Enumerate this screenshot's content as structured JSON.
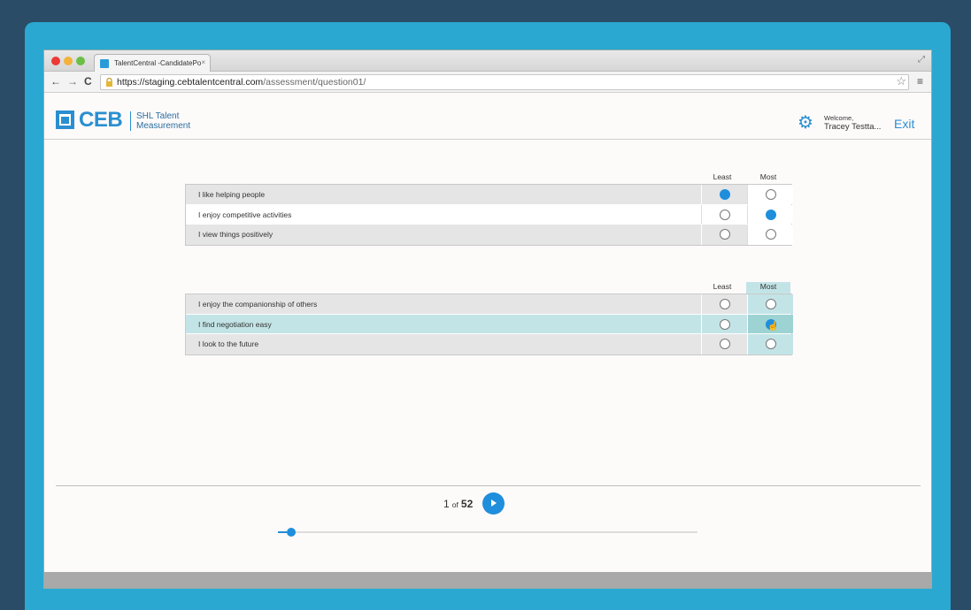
{
  "browser": {
    "tab_title": "TalentCentral -CandidatePo",
    "tab_close": "×",
    "url_host": "https://staging.cebtalentcentral.com",
    "url_path": "/assessment/question01/",
    "resize_glyph": "⤢",
    "star_glyph": "☆",
    "menu_glyph": "≡",
    "back_glyph": "←",
    "forward_glyph": "→",
    "reload_glyph": "C"
  },
  "header": {
    "logo_text": "CEB",
    "logo_sub1": "SHL Talent",
    "logo_sub2": "Measurement",
    "gear_glyph": "⚙",
    "welcome": "Welcome,",
    "user_name": "Tracey Testta...",
    "exit_label": "Exit"
  },
  "question_blocks": [
    {
      "least_label": "Least",
      "most_label": "Most",
      "rows": [
        {
          "text": "I like helping people",
          "least": true,
          "most": false
        },
        {
          "text": "I enjoy competitive activities",
          "least": false,
          "most": true
        },
        {
          "text": "I view things positively",
          "least": false,
          "most": false
        }
      ]
    },
    {
      "least_label": "Least",
      "most_label": "Most",
      "rows": [
        {
          "text": "I enjoy the companionship of others",
          "least": false,
          "most": false
        },
        {
          "text": "I find negotiation easy",
          "least": false,
          "most": true
        },
        {
          "text": "I look to the future",
          "least": false,
          "most": false
        }
      ]
    }
  ],
  "footer": {
    "page_current": "1",
    "page_of": "of",
    "page_total": "52",
    "progress_fraction": 0.0192
  },
  "colors": {
    "accent": "#1f8edc",
    "frame": "#2aa8d2",
    "background": "#2a4c66",
    "highlight": "#c3e4e6"
  }
}
